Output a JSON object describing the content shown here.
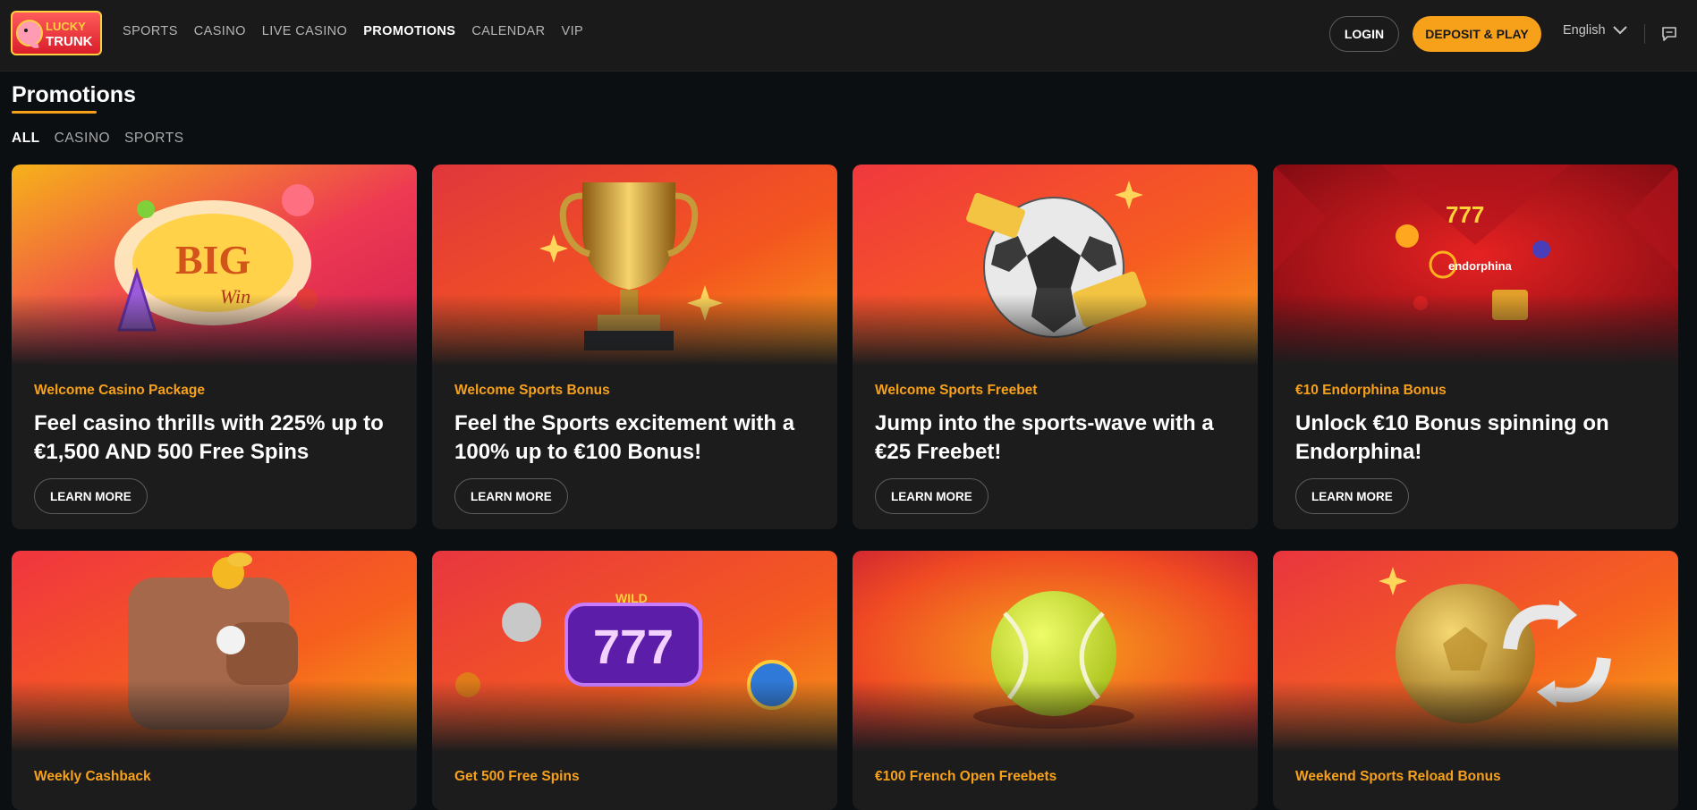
{
  "header": {
    "logo_text": "LUCKY TRUNK",
    "nav": [
      {
        "label": "SPORTS"
      },
      {
        "label": "CASINO"
      },
      {
        "label": "LIVE CASINO"
      },
      {
        "label": "PROMOTIONS"
      },
      {
        "label": "CALENDAR"
      },
      {
        "label": "VIP"
      }
    ],
    "active_nav": "PROMOTIONS",
    "login_label": "LOGIN",
    "deposit_label": "DEPOSIT & PLAY",
    "language": "English"
  },
  "page": {
    "title": "Promotions",
    "filters": [
      {
        "label": "ALL"
      },
      {
        "label": "CASINO"
      },
      {
        "label": "SPORTS"
      }
    ],
    "active_filter": "ALL"
  },
  "promotions": [
    {
      "category": "Welcome Casino Package",
      "headline": "Feel casino thrills with 225% up to €1,500 AND 500 Free Spins",
      "button": "LEARN MORE",
      "art": "big-win-slot"
    },
    {
      "category": "Welcome Sports Bonus",
      "headline": "Feel the Sports excitement with a 100% up to €100 Bonus!",
      "button": "LEARN MORE",
      "art": "gold-trophy"
    },
    {
      "category": "Welcome Sports Freebet",
      "headline": "Jump into the sports-wave with a €25 Freebet!",
      "button": "LEARN MORE",
      "art": "soccer-ball"
    },
    {
      "category": "€10 Endorphina Bonus",
      "headline": "Unlock €10 Bonus spinning on Endorphina!",
      "button": "LEARN MORE",
      "art": "endorphina-logo",
      "art_text": "endorphina"
    },
    {
      "category": "Weekly Cashback",
      "art": "wallet"
    },
    {
      "category": "Get 500 Free Spins",
      "art": "slot-777",
      "art_text": "WILD"
    },
    {
      "category": "€100 French Open Freebets",
      "art": "tennis-ball"
    },
    {
      "category": "Weekend Sports Reload Bonus",
      "art": "gold-ball-reload"
    }
  ],
  "colors": {
    "accent": "#f7a11a",
    "background": "#0b0f12",
    "card": "#1c1c1d",
    "header": "#1a1a1a"
  },
  "icons": [
    "chevron-down-icon",
    "chat-icon"
  ]
}
